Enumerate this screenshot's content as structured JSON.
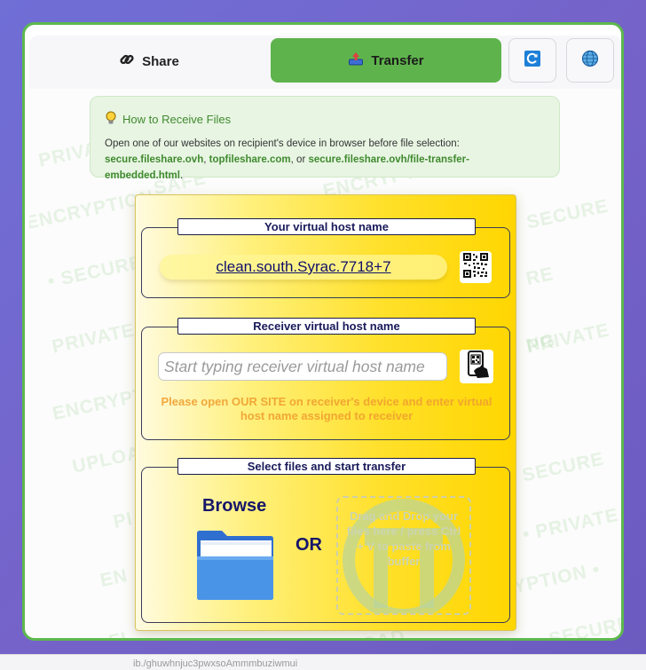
{
  "tabs": {
    "share_label": "Share",
    "transfer_label": "Transfer",
    "active": "transfer",
    "share_icon": "link-icon",
    "transfer_icon": "upload-tray-icon",
    "refresh_icon": "refresh-icon",
    "language_icon": "globe-icon"
  },
  "watermarks": [
    "PRIVATE",
    "SAFE",
    "ENCRYPTED",
    "• SECURE",
    "PRIVATE",
    "ENCRYPTION",
    "UPLOAD",
    "SECURE",
    "PRIVATE",
    "ENCRYPTION",
    "SECURE",
    "• PRIVATE",
    "RE",
    "NG",
    "EN",
    "PI",
    "FI",
    "UPLOAD",
    "SECURE",
    "YPTION •"
  ],
  "info": {
    "title": "How to Receive Files",
    "text_prefix": "Open one of our websites on recipient's device in browser before file selection:",
    "link1": "secure.fileshare.ovh",
    "sep1": ", ",
    "link2": "topfileshare.com",
    "sep2": ", or ",
    "link3": "secure.fileshare.ovh/file-transfer-embedded.html",
    "suffix": "."
  },
  "your_host": {
    "legend": "Your virtual host name",
    "value": "clean.south.Syrac.7718+7",
    "qr_icon": "qr-code-icon"
  },
  "receiver": {
    "legend": "Receiver virtual host name",
    "placeholder": "Start typing receiver virtual host name",
    "scan_icon": "phone-scan-icon",
    "hint": "Please open OUR SITE on receiver's device and enter virtual host name assigned to receiver"
  },
  "files": {
    "legend": "Select files and start transfer",
    "browse_label": "Browse",
    "folder_icon": "folder-icon",
    "or_label": "OR",
    "drop_text": "Drag and Drop your files here / press Ctrl + V to paste from buffer"
  },
  "colors": {
    "accent_green": "#5fb34d",
    "panel_yellow": "#ffe02a",
    "navy": "#15156a",
    "hint_orange": "#f0a030"
  },
  "bottom": {
    "text": "ib./ghuwhnjuc3pwxsoAmmmbuziwmui"
  }
}
